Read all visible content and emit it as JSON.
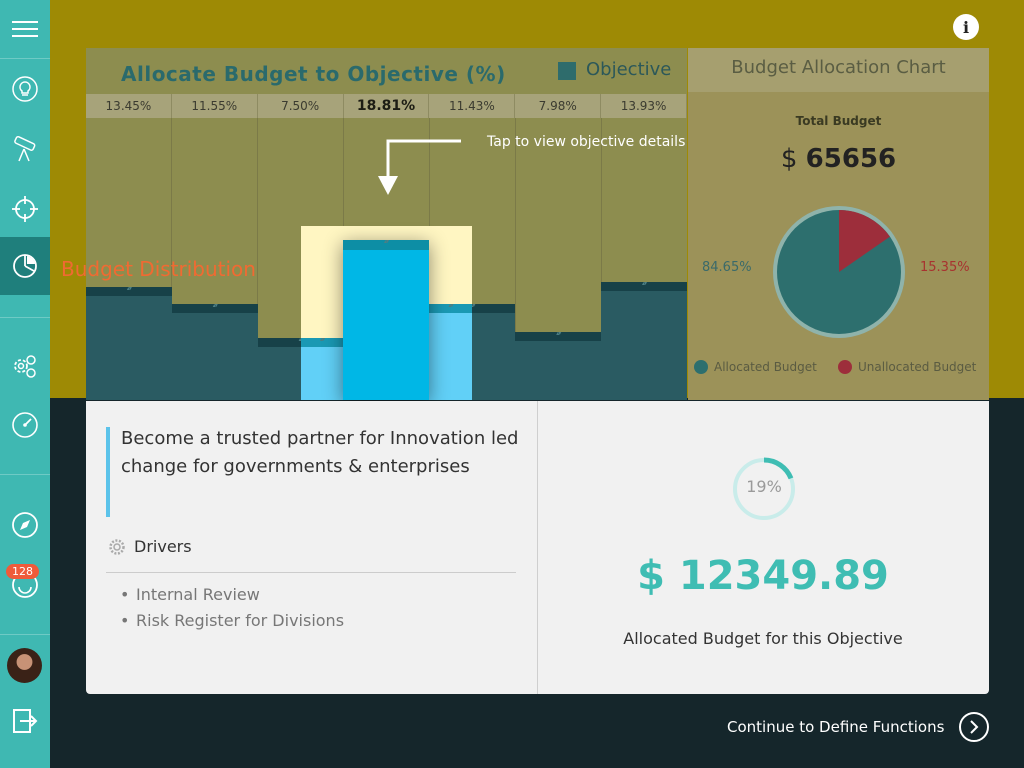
{
  "sidebar": {
    "items": [
      {
        "icon": "menu-icon"
      },
      {
        "icon": "lightbulb-icon"
      },
      {
        "icon": "telescope-icon"
      },
      {
        "icon": "crosshair-icon"
      },
      {
        "icon": "pie-chart-icon",
        "active": true
      },
      {
        "icon": "gears-icon"
      },
      {
        "icon": "speedometer-icon"
      },
      {
        "icon": "compass-icon"
      },
      {
        "icon": "smiley-icon"
      },
      {
        "icon": "avatar"
      },
      {
        "icon": "logout-icon"
      }
    ],
    "badge": "128"
  },
  "tour": {
    "budget_distribution_label": "Budget Distribution",
    "tap_hint": "Tap to view objective details"
  },
  "allocation": {
    "title": "Allocate Budget to Objective (%)",
    "legend_label": "Objective",
    "percentages": [
      "13.45%",
      "11.55%",
      "7.50%",
      "18.81%",
      "11.43%",
      "7.98%",
      "13.93%"
    ],
    "selected_index": 3,
    "bar_levels": [
      0.4,
      0.34,
      0.22,
      0.56,
      0.34,
      0.24,
      0.42
    ]
  },
  "chart_panel": {
    "title": "Budget Allocation Chart",
    "total_label": "Total Budget",
    "currency": "$",
    "total_value": "65656",
    "allocated_pct": "84.65%",
    "unallocated_pct": "15.35%",
    "allocated_share": 84.65,
    "legend_allocated": "Allocated Budget",
    "legend_unallocated": "Unallocated Budget",
    "colors": {
      "allocated": "#2d6f6e",
      "unallocated": "#9d2e3b"
    }
  },
  "objective": {
    "text": "Become a trusted partner for Innovation led change for governments & enterprises",
    "drivers_label": "Drivers",
    "drivers": [
      "Internal Review",
      "Risk Register for Divisions"
    ],
    "percent_label": "19%",
    "percent_value": 19,
    "amount": "$ 12349.89",
    "amount_label": "Allocated Budget for this Objective"
  },
  "footer": {
    "continue_label": "Continue to Define Functions"
  },
  "info_label": "i"
}
